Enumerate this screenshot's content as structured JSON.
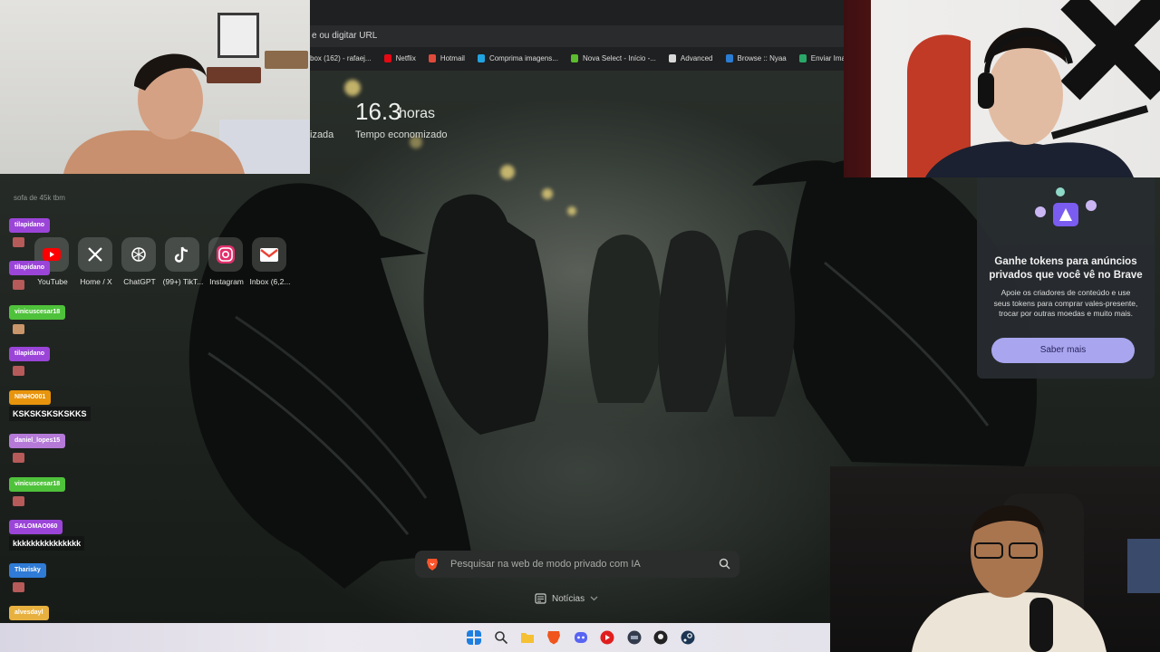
{
  "browser": {
    "address_placeholder": "e ou digitar URL",
    "bookmarks": [
      {
        "label": "box (162) - rafaej...",
        "icon": "gmail-icon",
        "color": "#2a2b2d"
      },
      {
        "label": "Netflix",
        "icon": "netflix-icon",
        "color": "#e50914"
      },
      {
        "label": "Hotmail",
        "icon": "outlook-icon",
        "color": "#e04a3a"
      },
      {
        "label": "Comprima imagens...",
        "icon": "compress-icon",
        "color": "#21a3e0"
      },
      {
        "label": "Nova Select - Início -...",
        "icon": "novaselect-icon",
        "color": "#5cbb2e"
      },
      {
        "label": "Advanced",
        "icon": "advanced-icon",
        "color": "#d8d8d8"
      },
      {
        "label": "Browse :: Nyaa",
        "icon": "nyaa-icon",
        "color": "#2b7cd3"
      },
      {
        "label": "Enviar Imagem",
        "icon": "upload-icon",
        "color": "#2aa869"
      }
    ]
  },
  "stats": {
    "left_label": "izada",
    "value": "16.3",
    "unit": "horas",
    "label": "Tempo economizado"
  },
  "shortcuts": [
    {
      "label": "YouTube",
      "icon": "youtube-icon"
    },
    {
      "label": "Home / X",
      "icon": "x-icon"
    },
    {
      "label": "ChatGPT",
      "icon": "chatgpt-icon"
    },
    {
      "label": "(99+) TikT...",
      "icon": "tiktok-icon"
    },
    {
      "label": "Instagram",
      "icon": "instagram-icon"
    },
    {
      "label": "Inbox (6,2...",
      "icon": "gmail-icon"
    }
  ],
  "search": {
    "placeholder": "Pesquisar na web de modo privado com IA"
  },
  "news": {
    "label": "Notícias"
  },
  "promo": {
    "title": "Ganhe tokens para anúncios privados que você vê no Brave",
    "body": "Apoie os criadores de conteúdo e use seus tokens para comprar vales-presente, trocar por outras moedas e muito mais.",
    "button": "Saber mais"
  },
  "chat": {
    "top_fragment": "sofa de 45k tbm",
    "messages": [
      {
        "user": "tilapidano",
        "color": "#9b45d8",
        "message": ""
      },
      {
        "user": "tilapidano",
        "color": "#9b45d8",
        "message": ""
      },
      {
        "user": "vinicuscesar18",
        "color": "#4fc23b",
        "message": ""
      },
      {
        "user": "tilapidano",
        "color": "#9b45d8",
        "message": ""
      },
      {
        "user": "NINHO001",
        "color": "#e8940c",
        "message": "KSKSKSKSKSKKS"
      },
      {
        "user": "daniel_lopes15",
        "color": "#b57ad8",
        "message": ""
      },
      {
        "user": "vinicuscesar18",
        "color": "#4fc23b",
        "message": ""
      },
      {
        "user": "SALOMAO060",
        "color": "#9b45d8",
        "message": "kkkkkkkkkkkkkkk"
      },
      {
        "user": "Tharisky",
        "color": "#2f7bd6",
        "message": ""
      },
      {
        "user": "alvesdayl",
        "color": "#e8b13f",
        "message": ""
      }
    ]
  },
  "taskbar": {
    "icons": [
      {
        "name": "windows-start-icon",
        "color": "#1f7fe0"
      },
      {
        "name": "search-icon",
        "color": "#4a4a4a"
      },
      {
        "name": "file-explorer-icon",
        "color": "#f5c033"
      },
      {
        "name": "brave-icon",
        "color": "#f0551d"
      },
      {
        "name": "discord-icon",
        "color": "#5865f2"
      },
      {
        "name": "youtube-music-icon",
        "color": "#e01e1e"
      },
      {
        "name": "app-icon",
        "color": "#333c4c"
      },
      {
        "name": "github-icon",
        "color": "#222222"
      },
      {
        "name": "steam-icon",
        "color": "#1b3553"
      }
    ]
  }
}
